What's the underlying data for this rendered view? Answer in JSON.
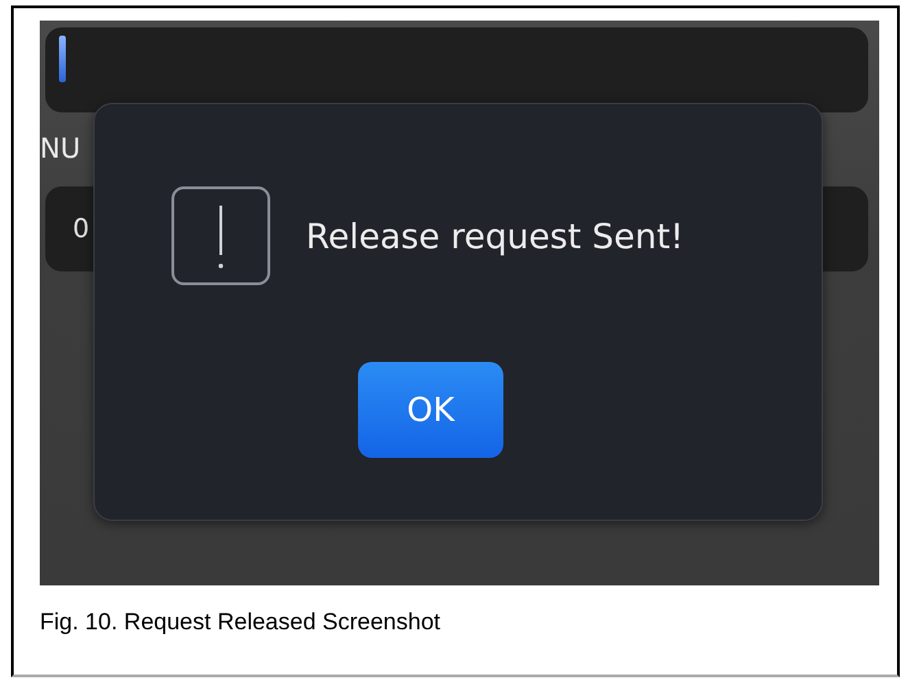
{
  "background": {
    "field_label": "NU",
    "field_value": "0"
  },
  "dialog": {
    "message": "Release request Sent!",
    "buttons": [
      "OK"
    ]
  },
  "caption": "Fig. 10. Request Released Screenshot"
}
